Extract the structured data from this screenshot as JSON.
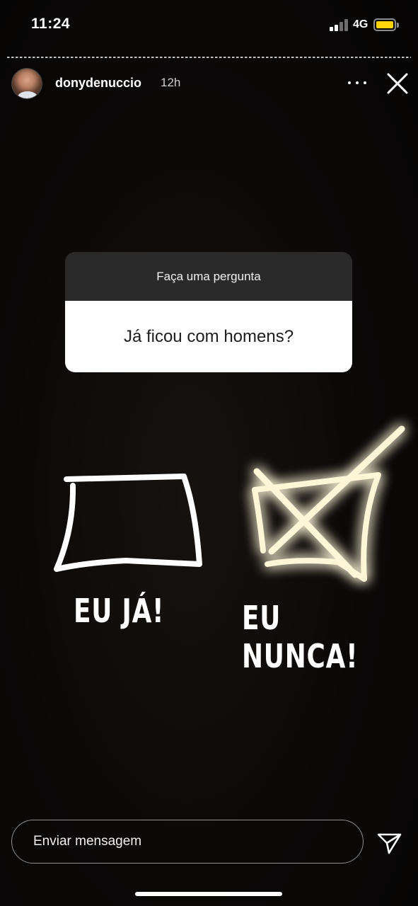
{
  "status_bar": {
    "time": "11:24",
    "network": "4G",
    "battery_color": "#ffd60a"
  },
  "story": {
    "username": "donydenuccio",
    "time_ago": "12h",
    "more_icon": "more-horizontal-icon",
    "close_icon": "close-icon"
  },
  "question_sticker": {
    "header": "Faça uma pergunta",
    "question": "Já ficou com homens?"
  },
  "drawings": {
    "left_caption": "EU JÁ!",
    "right_caption": "EU NUNCA!",
    "glow_color": "#f5d77a"
  },
  "footer": {
    "message_placeholder": "Enviar mensagem",
    "send_icon": "send-icon"
  }
}
